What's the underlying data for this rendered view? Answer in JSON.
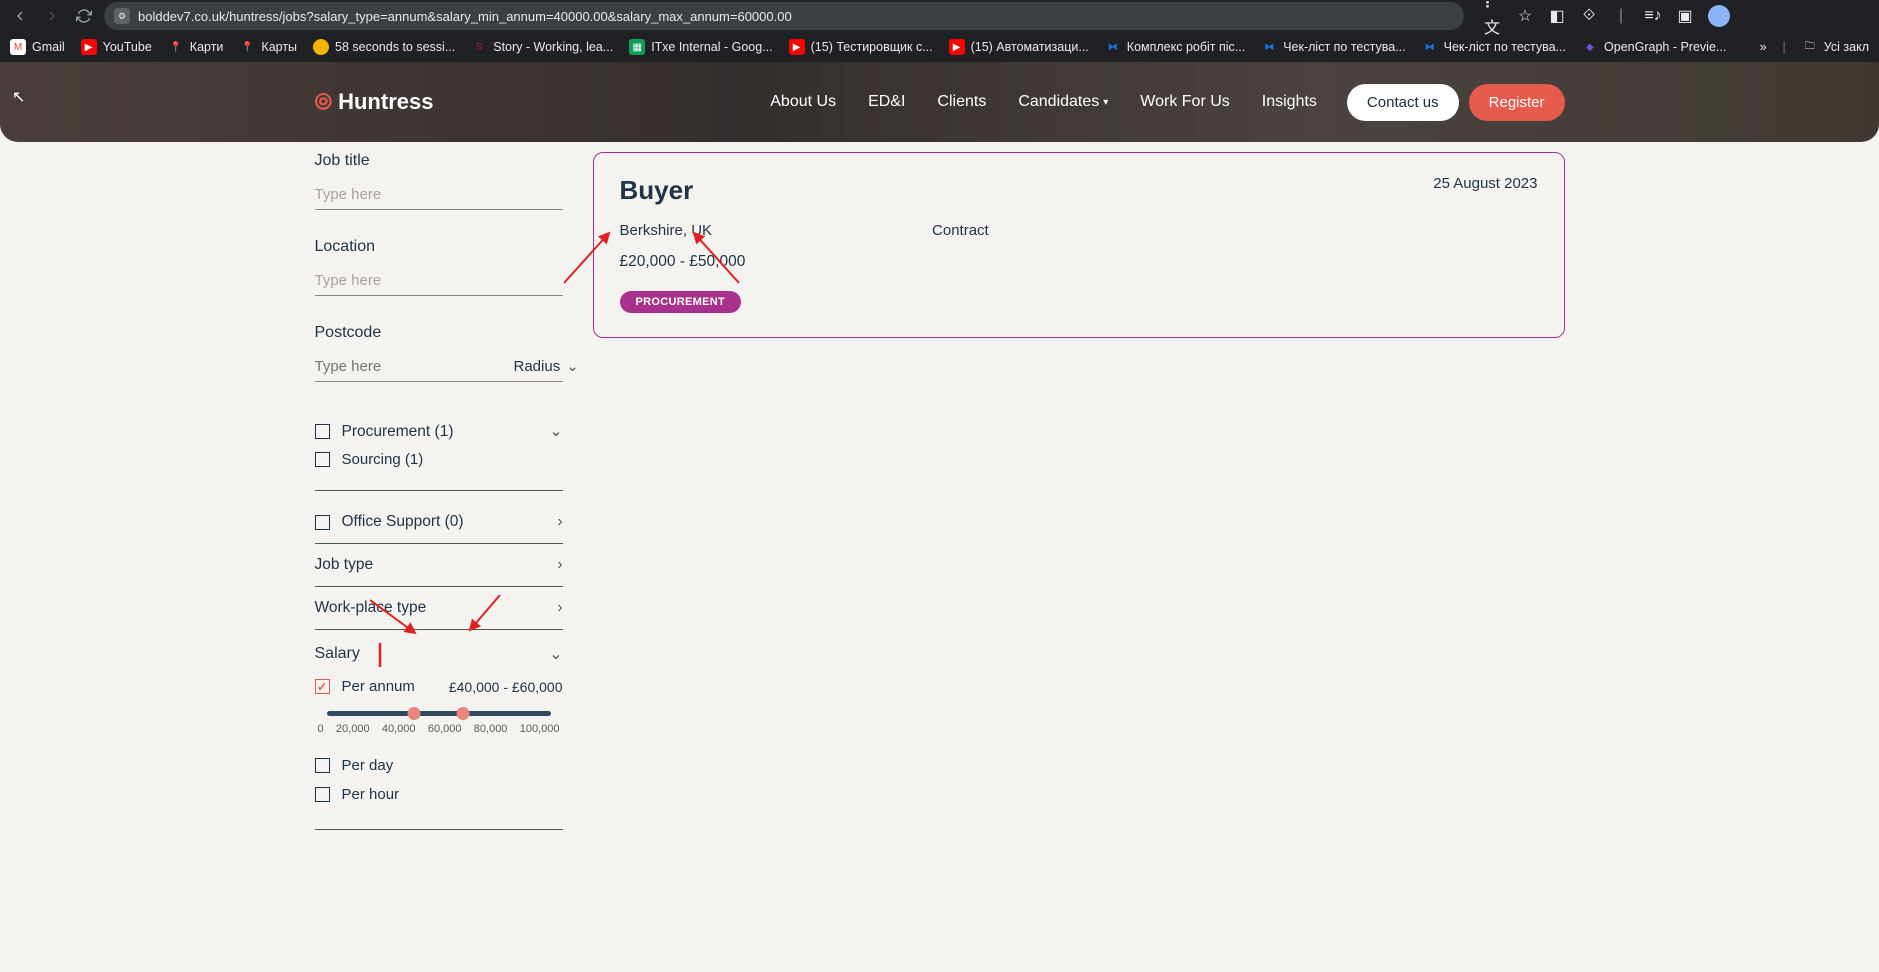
{
  "browser": {
    "url": "bolddev7.co.uk/huntress/jobs?salary_type=annum&salary_min_annum=40000.00&salary_max_annum=60000.00"
  },
  "bookmarks": [
    {
      "label": "Gmail",
      "color": "#ea4335"
    },
    {
      "label": "YouTube",
      "color": "#ff0000"
    },
    {
      "label": "Карти",
      "color": "#34a853"
    },
    {
      "label": "Карты",
      "color": "#34a853"
    },
    {
      "label": "58 seconds to sessi...",
      "color": "#f4b400"
    },
    {
      "label": "Story - Working, lea...",
      "color": "#c2185b"
    },
    {
      "label": "ITхе Internal - Goog...",
      "color": "#0f9d58"
    },
    {
      "label": "(15) Тестировщик с...",
      "color": "#ff0000"
    },
    {
      "label": "(15) Автоматизаци...",
      "color": "#ff0000"
    },
    {
      "label": "Комплекс робіт піс...",
      "color": "#1a73e8"
    },
    {
      "label": "Чек-ліст по тестува...",
      "color": "#1a73e8"
    },
    {
      "label": "Чек-ліст по тестува...",
      "color": "#1a73e8"
    },
    {
      "label": "OpenGraph - Previe...",
      "color": "#6a52d6"
    }
  ],
  "bookmarks_tail": {
    "all": "Усі закл"
  },
  "header": {
    "logo": "Huntress",
    "nav": {
      "about": "About Us",
      "eddi": "ED&I",
      "clients": "Clients",
      "candidates": "Candidates",
      "work": "Work For Us",
      "insights": "Insights"
    },
    "contact": "Contact us",
    "register": "Register"
  },
  "filters": {
    "job_title_label": "Job title",
    "job_title_ph": "Type here",
    "location_label": "Location",
    "location_ph": "Type here",
    "postcode_label": "Postcode",
    "postcode_ph": "Type here",
    "radius_label": "Radius",
    "cat_procurement": "Procurement (1)",
    "cat_sourcing": "Sourcing (1)",
    "cat_office": "Office Support (0)",
    "job_type_label": "Job type",
    "workplace_label": "Work-place type",
    "salary_label": "Salary",
    "per_annum": "Per annum",
    "salary_range": "£40,000 - £60,000",
    "ticks": {
      "t0": "0",
      "t1": "20,000",
      "t2": "40,000",
      "t3": "60,000",
      "t4": "80,000",
      "t5": "100,000"
    },
    "per_day": "Per day",
    "per_hour": "Per hour"
  },
  "job": {
    "title": "Buyer",
    "date": "25 August 2023",
    "location": "Berkshire, UK",
    "type": "Contract",
    "salary": "£20,000 - £50,000",
    "tag": "PROCUREMENT"
  }
}
